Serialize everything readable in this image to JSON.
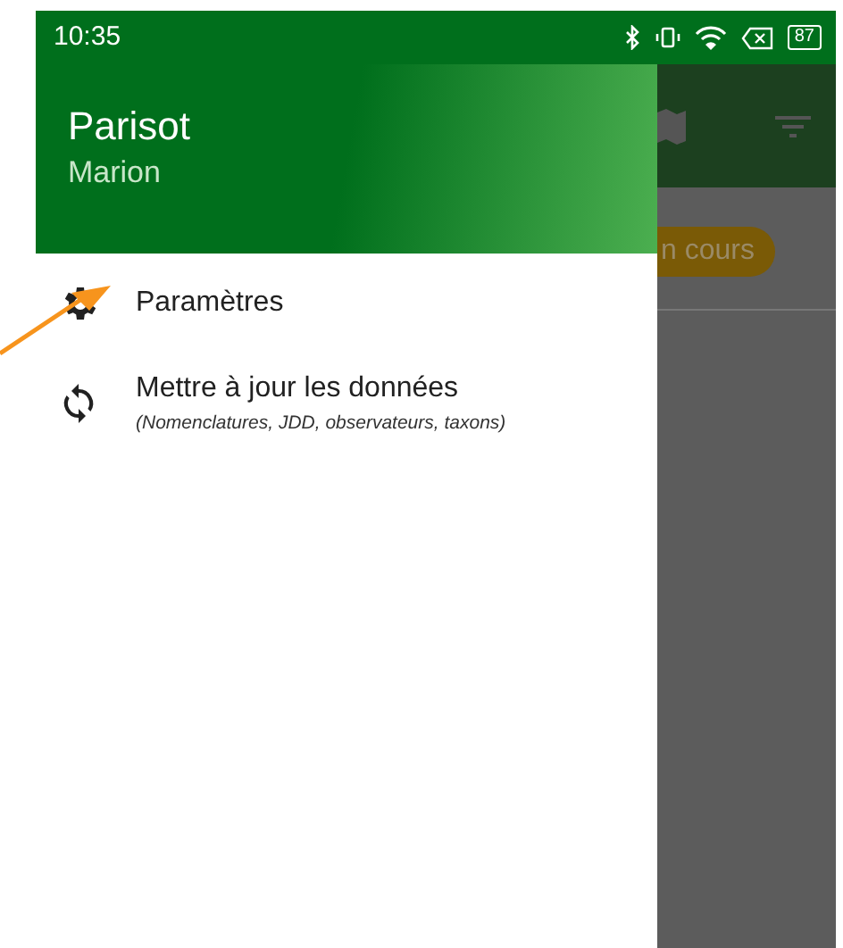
{
  "status_bar": {
    "time": "10:35",
    "battery": "87"
  },
  "drawer": {
    "header": {
      "title": "Parisot",
      "subtitle": "Marion"
    },
    "items": [
      {
        "kind": "settings",
        "label": "Paramètres"
      },
      {
        "kind": "sync",
        "label": "Mettre à jour les données",
        "sublabel": "(Nomenclatures, JDD, observateurs, taxons)"
      }
    ]
  },
  "background_app": {
    "chip": "n cours"
  },
  "annotation": {
    "kind": "arrow",
    "color": "#f7941d"
  }
}
